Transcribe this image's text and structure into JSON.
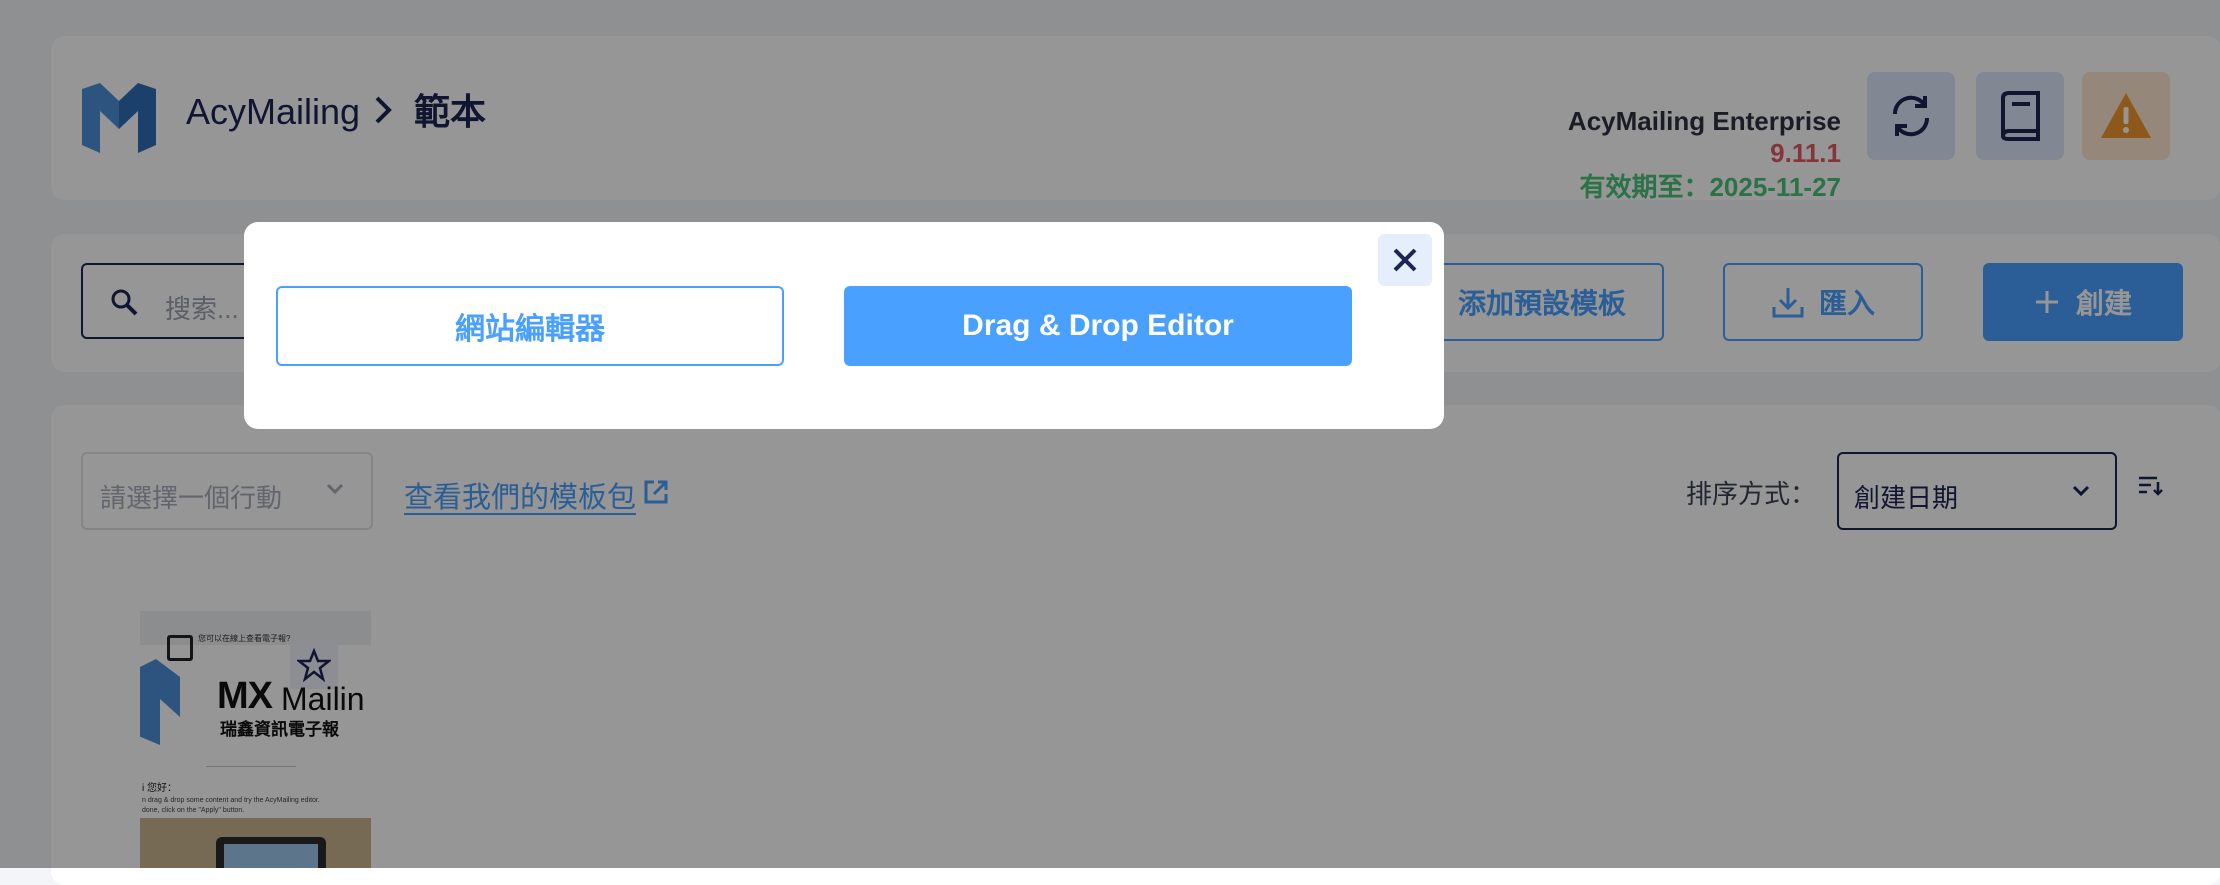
{
  "header": {
    "app_name": "AcyMailing",
    "separator": ">",
    "page": "範本",
    "edition": "AcyMailing Enterprise",
    "version": "9.11.1",
    "expiry": "有效期至：2025-11-27",
    "colors": {
      "version": "#e15a63",
      "expiry": "#49c37a",
      "primary": "#4aa0ff",
      "navy": "#1c2553"
    }
  },
  "toolbar": {
    "search_placeholder": "搜索...",
    "add_preset_label": "添加預設模板",
    "import_label": "匯入",
    "create_label": "創建"
  },
  "content": {
    "action_placeholder": "請選擇一個行動",
    "packs_link": "查看我們的模板包",
    "sort_label": "排序方式：",
    "sort_value": "創建日期"
  },
  "thumbnail": {
    "top_line": "您可以在線上查看電子報?",
    "brand_mx": "MX",
    "brand_mailing": "Mailin",
    "tagline": "瑞鑫資訊電子報",
    "greeting": "i 您好：",
    "line1": "n drag & drop some content and try the AcyMailing editor.",
    "line2": "done, click on the \"Apply\" button."
  },
  "modal": {
    "website_editor_label": "網站編輯器",
    "dnd_editor_label": "Drag & Drop Editor"
  },
  "icons": [
    "acymailing-logo-icon",
    "refresh-icon",
    "documentation-icon",
    "warning-icon",
    "search-icon",
    "download-icon",
    "plus-icon",
    "chevron-down-icon",
    "external-link-icon",
    "sort-order-icon",
    "checkbox-icon",
    "star-icon",
    "close-icon"
  ]
}
